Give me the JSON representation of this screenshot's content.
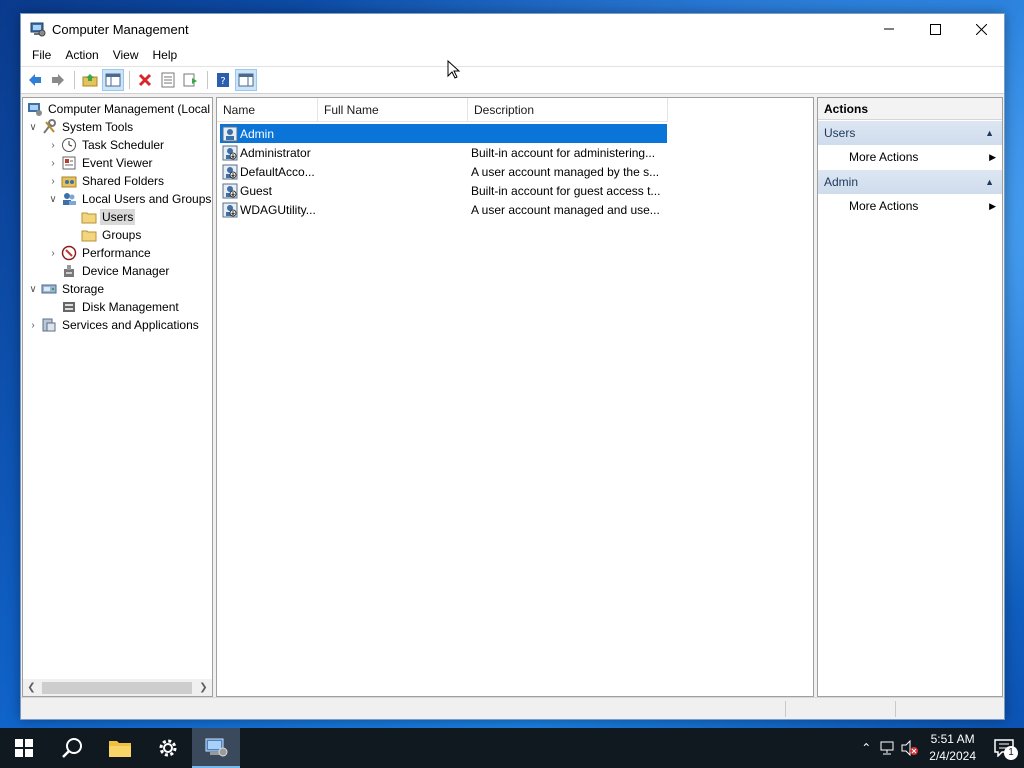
{
  "window": {
    "title": "Computer Management",
    "menu": [
      "File",
      "Action",
      "View",
      "Help"
    ]
  },
  "toolbar": {
    "buttons": [
      "back-arrow-icon",
      "forward-arrow-icon",
      "up-folder-icon",
      "show-hide-tree-icon",
      "delete-icon",
      "properties-icon",
      "export-list-icon",
      "help-icon",
      "show-hide-action-pane-icon"
    ]
  },
  "tree": {
    "items": [
      {
        "label": "Computer Management (Local",
        "level": 0,
        "expander": ""
      },
      {
        "label": "System Tools",
        "level": 1,
        "expander": "expanded"
      },
      {
        "label": "Task Scheduler",
        "level": 2,
        "expander": "collapsed"
      },
      {
        "label": "Event Viewer",
        "level": 2,
        "expander": "collapsed"
      },
      {
        "label": "Shared Folders",
        "level": 2,
        "expander": "collapsed"
      },
      {
        "label": "Local Users and Groups",
        "level": 2,
        "expander": "expanded"
      },
      {
        "label": "Users",
        "level": 3,
        "expander": "",
        "selected": true
      },
      {
        "label": "Groups",
        "level": 3,
        "expander": ""
      },
      {
        "label": "Performance",
        "level": 2,
        "expander": "collapsed"
      },
      {
        "label": "Device Manager",
        "level": 2,
        "expander": ""
      },
      {
        "label": "Storage",
        "level": 1,
        "expander": "expanded"
      },
      {
        "label": "Disk Management",
        "level": 2,
        "expander": ""
      },
      {
        "label": "Services and Applications",
        "level": 1,
        "expander": "collapsed"
      }
    ]
  },
  "list": {
    "columns": [
      "Name",
      "Full Name",
      "Description"
    ],
    "rows": [
      {
        "name": "Admin",
        "full_name": "",
        "description": "",
        "selected": true
      },
      {
        "name": "Administrator",
        "full_name": "",
        "description": "Built-in account for administering..."
      },
      {
        "name": "DefaultAcco...",
        "full_name": "",
        "description": "A user account managed by the s..."
      },
      {
        "name": "Guest",
        "full_name": "",
        "description": "Built-in account for guest access t..."
      },
      {
        "name": "WDAGUtility...",
        "full_name": "",
        "description": "A user account managed and use..."
      }
    ]
  },
  "actions": {
    "title": "Actions",
    "sections": [
      {
        "header": "Users",
        "items": [
          "More Actions"
        ]
      },
      {
        "header": "Admin",
        "items": [
          "More Actions"
        ]
      }
    ]
  },
  "taskbar": {
    "time": "5:51 AM",
    "date": "2/4/2024",
    "notification_count": "1"
  },
  "colors": {
    "selection": "#0a74d9",
    "section_header": "#d6e2f0",
    "taskbar": "#101820"
  }
}
